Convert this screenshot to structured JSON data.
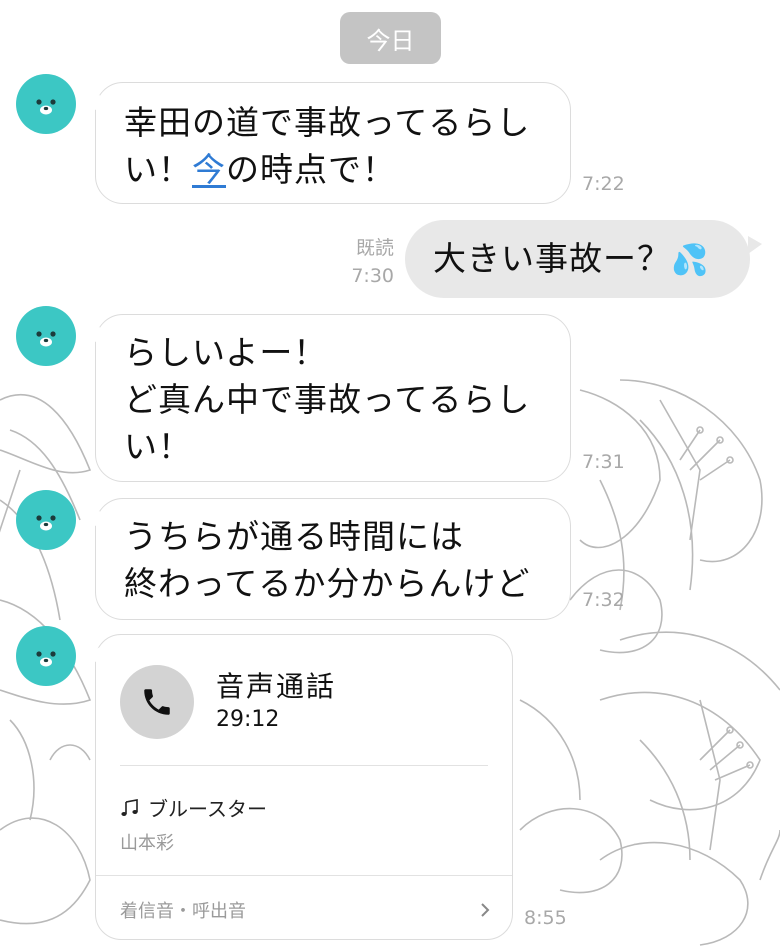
{
  "date_label": "今日",
  "messages": [
    {
      "text": "幸田の道で事故ってるらし",
      "text2a": "い！",
      "link": "今",
      "text2b": "の時点で！",
      "time": "7:22"
    },
    {
      "read": "既読",
      "time": "7:30",
      "text": "大きい事故ー？",
      "emoji": "💦"
    },
    {
      "text": "らしいよー！\nど真ん中で事故ってるらし\nい！",
      "time": "7:31"
    },
    {
      "text": "うちらが通る時間には\n終わってるか分からんけど",
      "time": "7:32"
    }
  ],
  "call": {
    "title": "音声通話",
    "duration": "29:12",
    "song": "ブルースター",
    "artist": "山本彩",
    "ringtone_label": "着信音・呼出音",
    "time": "8:55"
  },
  "colors": {
    "avatar": "#3cc7c4",
    "link": "#2f7bd4",
    "outgoing_bubble": "#e8e8e8"
  },
  "icons": {
    "avatar": "bear-face-icon",
    "phone": "phone-icon",
    "music": "music-note-icon",
    "chevron": "chevron-right-icon",
    "emoji": "sweat-droplets-icon"
  }
}
